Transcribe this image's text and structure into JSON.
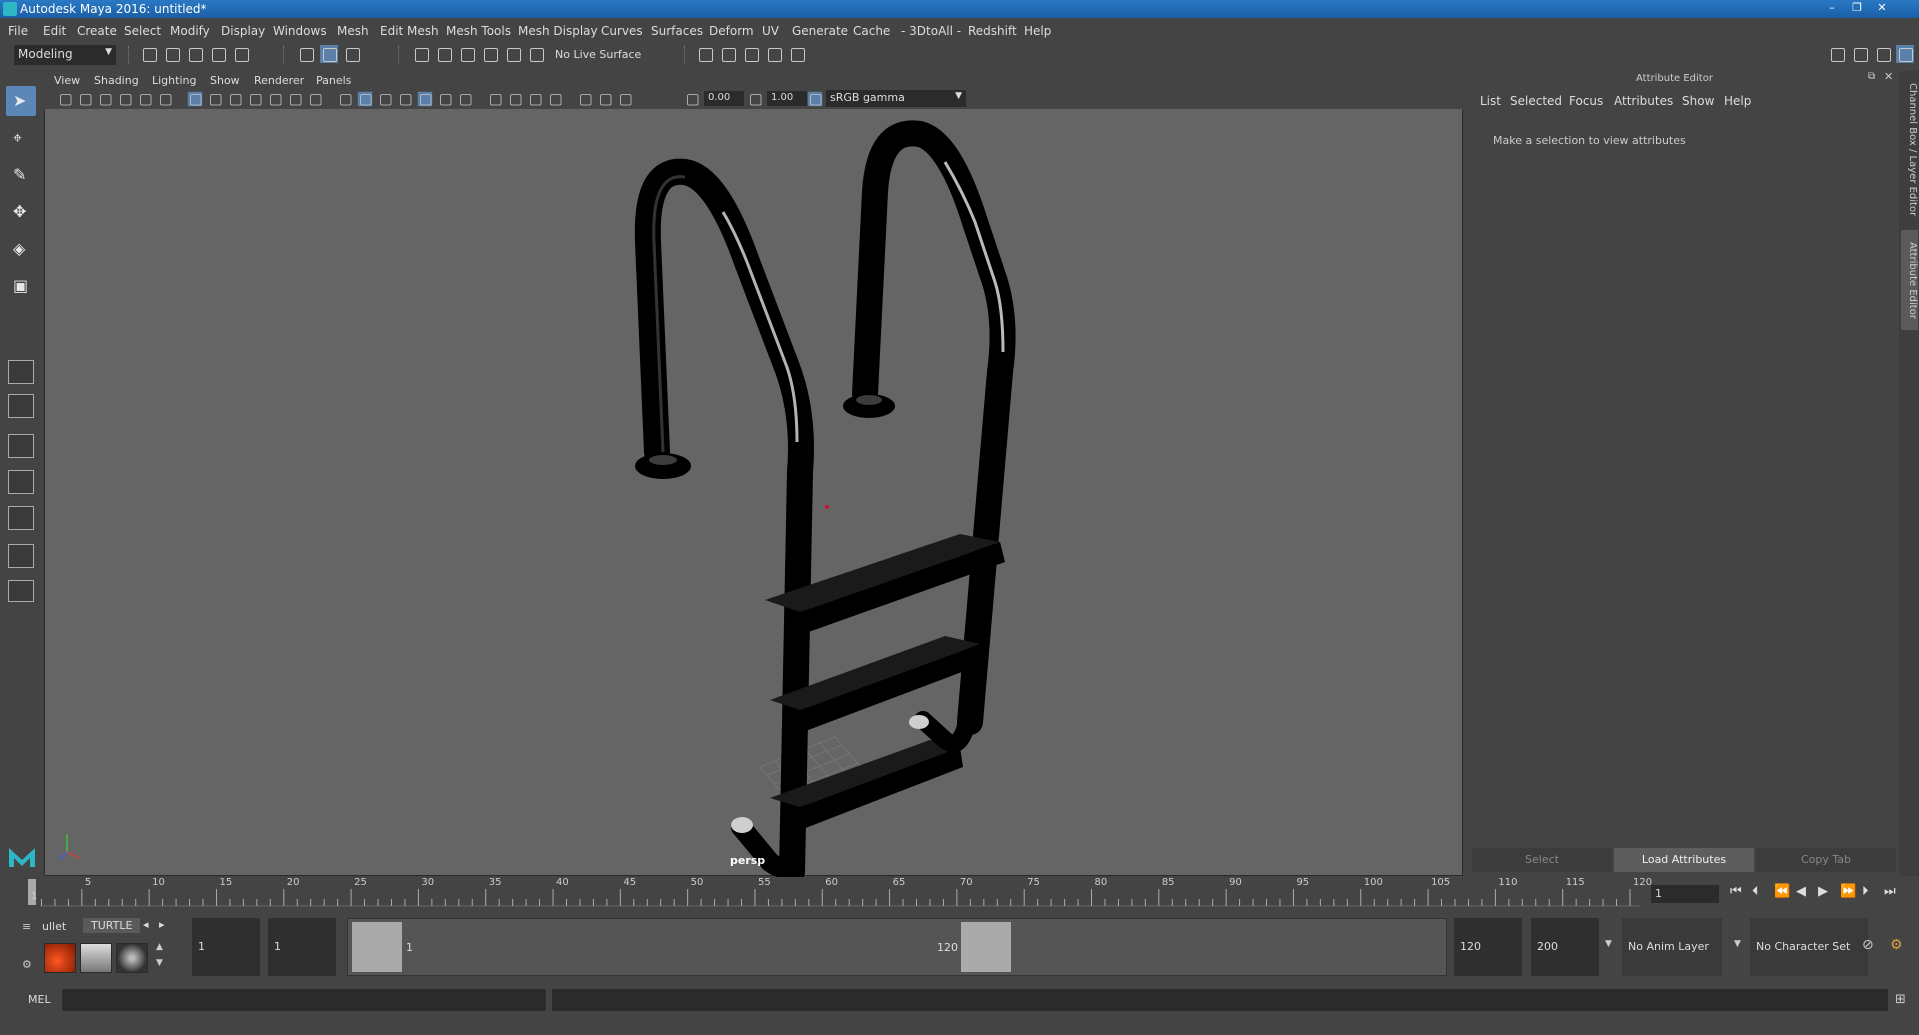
{
  "window": {
    "title": "Autodesk Maya 2016: untitled*",
    "min": "–",
    "max": "❐",
    "close": "✕"
  },
  "menu": [
    "File",
    "Edit",
    "Create",
    "Select",
    "Modify",
    "Display",
    "Windows",
    "Mesh",
    "Edit Mesh",
    "Mesh Tools",
    "Mesh Display",
    "Curves",
    "Surfaces",
    "Deform",
    "UV",
    "Generate",
    "Cache",
    "- 3DtoAll -",
    "Redshift",
    "Help"
  ],
  "mode_selector": "Modeling",
  "live_surface": "No Live Surface",
  "viewport": {
    "menu": [
      "View",
      "Shading",
      "Lighting",
      "Show",
      "Renderer",
      "Panels"
    ],
    "exposure": "0.00",
    "gamma": "1.00",
    "color_space": "sRGB gamma",
    "camera_label": "persp"
  },
  "attribute_editor": {
    "title": "Attribute Editor",
    "menu": [
      "List",
      "Selected",
      "Focus",
      "Attributes",
      "Show",
      "Help"
    ],
    "message": "Make a selection to view attributes",
    "buttons": {
      "select": "Select",
      "load": "Load Attributes",
      "copy": "Copy Tab"
    },
    "side_tabs": {
      "channel_box": "Channel Box / Layer Editor",
      "attribute_editor": "Attribute Editor"
    }
  },
  "timeline": {
    "ticks": [
      "1",
      "5",
      "10",
      "15",
      "20",
      "25",
      "30",
      "35",
      "40",
      "45",
      "50",
      "55",
      "60",
      "65",
      "70",
      "75",
      "80",
      "85",
      "90",
      "95",
      "100",
      "105",
      "110",
      "115",
      "120"
    ],
    "current_frame": "1"
  },
  "range": {
    "start": "1",
    "anim_start": "1",
    "slider_start": "1",
    "slider_end": "120",
    "anim_end": "120",
    "end": "200",
    "anim_layer": "No Anim Layer",
    "character_set": "No Character Set"
  },
  "shelf": {
    "tab_bullet": "ullet",
    "tab_turtle": "TURTLE"
  },
  "command": {
    "label": "MEL"
  },
  "colors": {
    "title_bar": "#1f6bb5",
    "panel": "#444444",
    "viewport_bg": "#656565",
    "active_tool": "#5b87b6"
  }
}
